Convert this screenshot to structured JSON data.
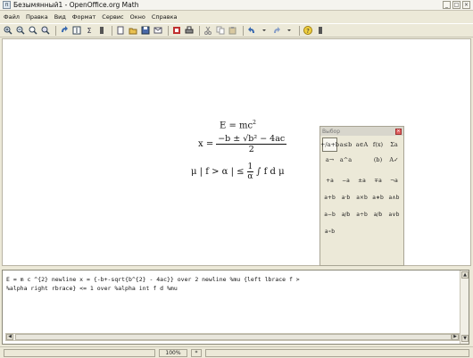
{
  "window": {
    "title": "Безымянный1 - OpenOffice.org Math",
    "minimize": "_",
    "maximize": "□",
    "close": "×"
  },
  "menu": [
    "Файл",
    "Правка",
    "Вид",
    "Формат",
    "Сервис",
    "Окно",
    "Справка"
  ],
  "toolbar": {
    "icons": [
      "zoom-in-icon",
      "zoom-out-icon",
      "zoom-100-icon",
      "zoom-all-icon",
      "update-icon",
      "formula-cursor-icon",
      "sigma-icon",
      "new-icon",
      "open-icon",
      "save-icon",
      "mail-icon",
      "pdf-icon",
      "print-icon",
      "cut-icon",
      "copy-icon",
      "paste-icon",
      "undo-icon",
      "redo-icon",
      "help-icon"
    ],
    "sigma": "Σ"
  },
  "formula": {
    "line1": "E = mc",
    "line1_sup": "2",
    "line2_lhs": "x =",
    "line2_num": "−b ± √b² − 4ac",
    "line2_den": "2",
    "line3_lhs": "μ | f > α | ≤",
    "line3_num": "1",
    "line3_den": "α",
    "line3_rhs": "∫ f d μ"
  },
  "palette": {
    "title": "Выбор",
    "categories": [
      "+/a+b",
      "a≤b",
      "a∈A",
      "f(x)",
      "Σa",
      "a→",
      "a^a",
      "",
      "(b)",
      "A✓"
    ],
    "symbols": [
      "+a",
      "−a",
      "±a",
      "∓a",
      "¬a",
      "a+b",
      "a·b",
      "a×b",
      "a∗b",
      "a∧b",
      "a−b",
      "a/b",
      "a÷b",
      "a/b",
      "a∨b",
      "a∘b"
    ]
  },
  "command": {
    "text": "E = m c ^{2} newline x = {-b+-sqrt{b^{2} - 4ac}} over 2 newline %mu {left lbrace f >\n%alpha right rbrace} <= 1 over %alpha int f d %mu"
  },
  "status": {
    "zoom": "100%",
    "mode": "*"
  },
  "colors": {
    "chrome": "#ece9d8",
    "document": "#ffffff"
  }
}
